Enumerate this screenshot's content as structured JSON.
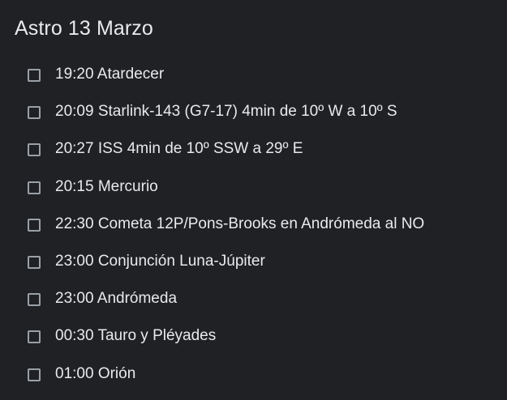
{
  "note": {
    "title": "Astro 13 Marzo",
    "items": [
      {
        "text": "19:20 Atardecer",
        "checked": false
      },
      {
        "text": "20:09 Starlink-143 (G7-17) 4min de 10º W a 10º S",
        "checked": false
      },
      {
        "text": "20:27 ISS 4min de 10º SSW a 29º E",
        "checked": false
      },
      {
        "text": "20:15 Mercurio",
        "checked": false
      },
      {
        "text": "22:30 Cometa 12P/Pons-Brooks en Andrómeda al NO",
        "checked": false
      },
      {
        "text": "23:00 Conjunción Luna-Júpiter",
        "checked": false
      },
      {
        "text": "23:00 Andrómeda",
        "checked": false
      },
      {
        "text": "00:30 Tauro y Pléyades",
        "checked": false
      },
      {
        "text": "01:00 Orión",
        "checked": false
      }
    ]
  },
  "colors": {
    "background": "#202124",
    "text": "#e8eaed",
    "checkbox_border": "#9aa0a6"
  },
  "icons": {
    "checkbox": "checkbox-unchecked-icon"
  }
}
